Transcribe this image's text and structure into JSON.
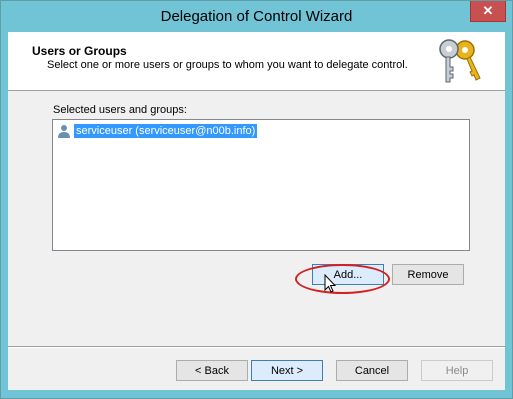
{
  "window": {
    "title": "Delegation of Control Wizard",
    "close_glyph": "✕"
  },
  "header": {
    "title": "Users or Groups",
    "subtitle": "Select one or more users or groups to whom you want to delegate control.",
    "icon": "keys-icon"
  },
  "selection": {
    "label": "Selected users and groups:",
    "items": [
      {
        "text": "serviceuser (serviceuser@n00b.info)",
        "icon": "user-icon",
        "selected": true
      }
    ]
  },
  "buttons": {
    "add": "Add...",
    "remove": "Remove",
    "back": "< Back",
    "next": "Next >",
    "cancel": "Cancel",
    "help": "Help"
  },
  "colors": {
    "titlebar": "#71c3d6",
    "selection": "#3399ff",
    "highlight_ring": "#d42020",
    "close_button": "#c75050"
  }
}
